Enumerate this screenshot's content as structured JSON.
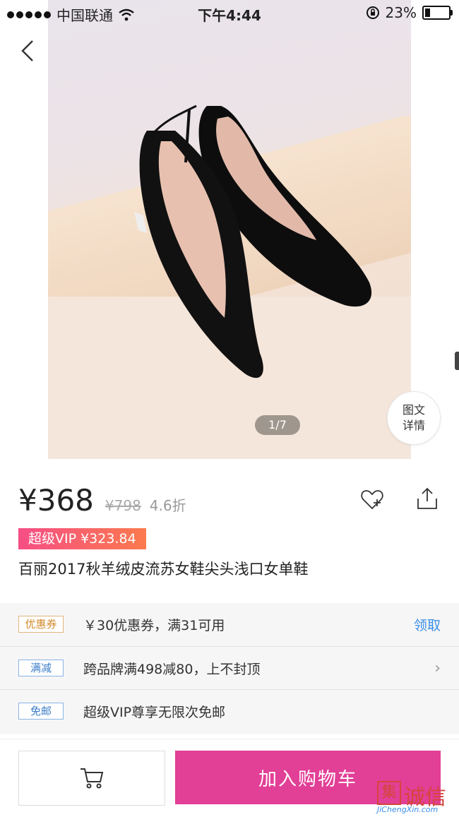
{
  "status": {
    "carrier": "中国联通",
    "time": "下午4:44",
    "battery": "23%",
    "battery_level": 0.23
  },
  "gallery": {
    "pager": "1/7",
    "detail_tab": [
      "图文",
      "详情"
    ]
  },
  "product": {
    "price": "¥368",
    "original_price": "¥798",
    "discount": "4.6折",
    "vip_price": "超级VIP ¥323.84",
    "title": "百丽2017秋羊绒皮流苏女鞋尖头浅口女单鞋"
  },
  "promos": [
    {
      "tag": "优惠券",
      "text": "￥30优惠券，满31可用",
      "action": "领取"
    },
    {
      "tag": "满减",
      "text": "跨品牌满498减80，上不封顶",
      "action": "›"
    },
    {
      "tag": "免邮",
      "text": "超级VIP尊享无限次免邮"
    }
  ],
  "bottom": {
    "add_to_cart": "加入购物车"
  },
  "watermark": {
    "brand": "诚信",
    "mark": "集",
    "site": "JiChengXin.com"
  },
  "colors": {
    "accent": "#e23f96",
    "link": "#3a8ee6",
    "vip_start": "#f64e85",
    "vip_end": "#fb7a4e"
  },
  "icons": [
    "back-icon",
    "favorite-add-icon",
    "share-icon",
    "cart-icon",
    "chevron-right-icon",
    "wifi-icon",
    "lock-rotation-icon",
    "battery-icon"
  ]
}
